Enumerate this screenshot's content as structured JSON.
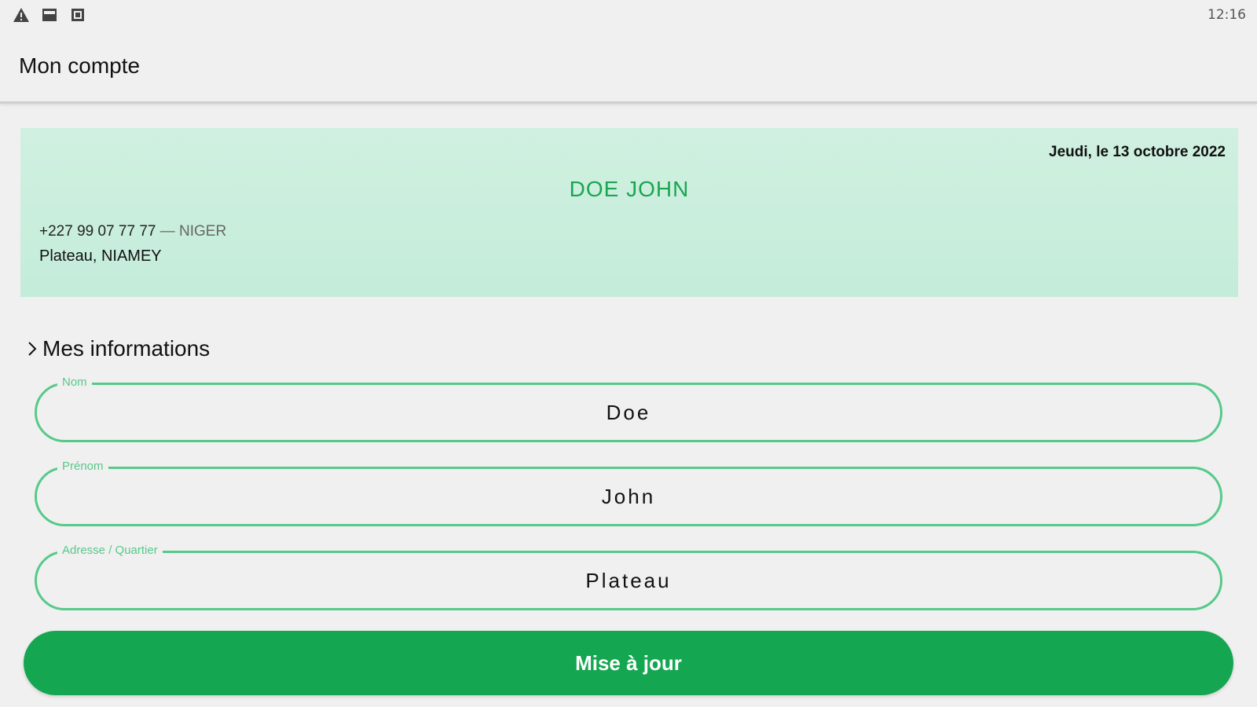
{
  "status_bar": {
    "icons": [
      "warning-icon",
      "image-icon",
      "screenshot-icon"
    ],
    "time": "12:16"
  },
  "app_bar": {
    "title": "Mon compte"
  },
  "profile": {
    "date": "Jeudi, le 13 octobre 2022",
    "name": "DOE JOHN",
    "phone": "+227 99 07 77 77",
    "separator": " — ",
    "country": "NIGER",
    "address": "Plateau, NIAMEY"
  },
  "section": {
    "title": "Mes informations"
  },
  "form": {
    "fields": [
      {
        "label": "Nom",
        "value": "Doe"
      },
      {
        "label": "Prénom",
        "value": "John"
      },
      {
        "label": "Adresse / Quartier",
        "value": "Plateau"
      }
    ],
    "submit_label": "Mise à jour"
  },
  "colors": {
    "accent": "#15a651",
    "field_border": "#57c98a",
    "card_bg": "#c8eddb",
    "page_bg": "#f0f0f0"
  }
}
